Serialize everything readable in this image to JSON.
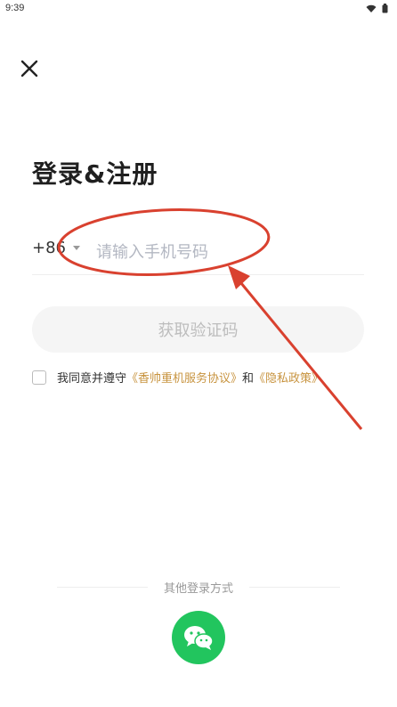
{
  "status_bar": {
    "time": "9:39"
  },
  "page": {
    "title": "登录&注册"
  },
  "phone": {
    "country_code": "+86",
    "placeholder": "请输入手机号码",
    "value": ""
  },
  "buttons": {
    "get_code": "获取验证码"
  },
  "agreement": {
    "prefix": "我同意并遵守",
    "service_link": "《香帅重机服务协议》",
    "conjunction": "和",
    "privacy_link": "《隐私政策》"
  },
  "other_login": {
    "label": "其他登录方式",
    "wechat_icon": "wechat-icon"
  },
  "colors": {
    "link": "#c89440",
    "wechat": "#22c55e",
    "annotation": "#d9412f",
    "placeholder": "#b3b7c2"
  }
}
